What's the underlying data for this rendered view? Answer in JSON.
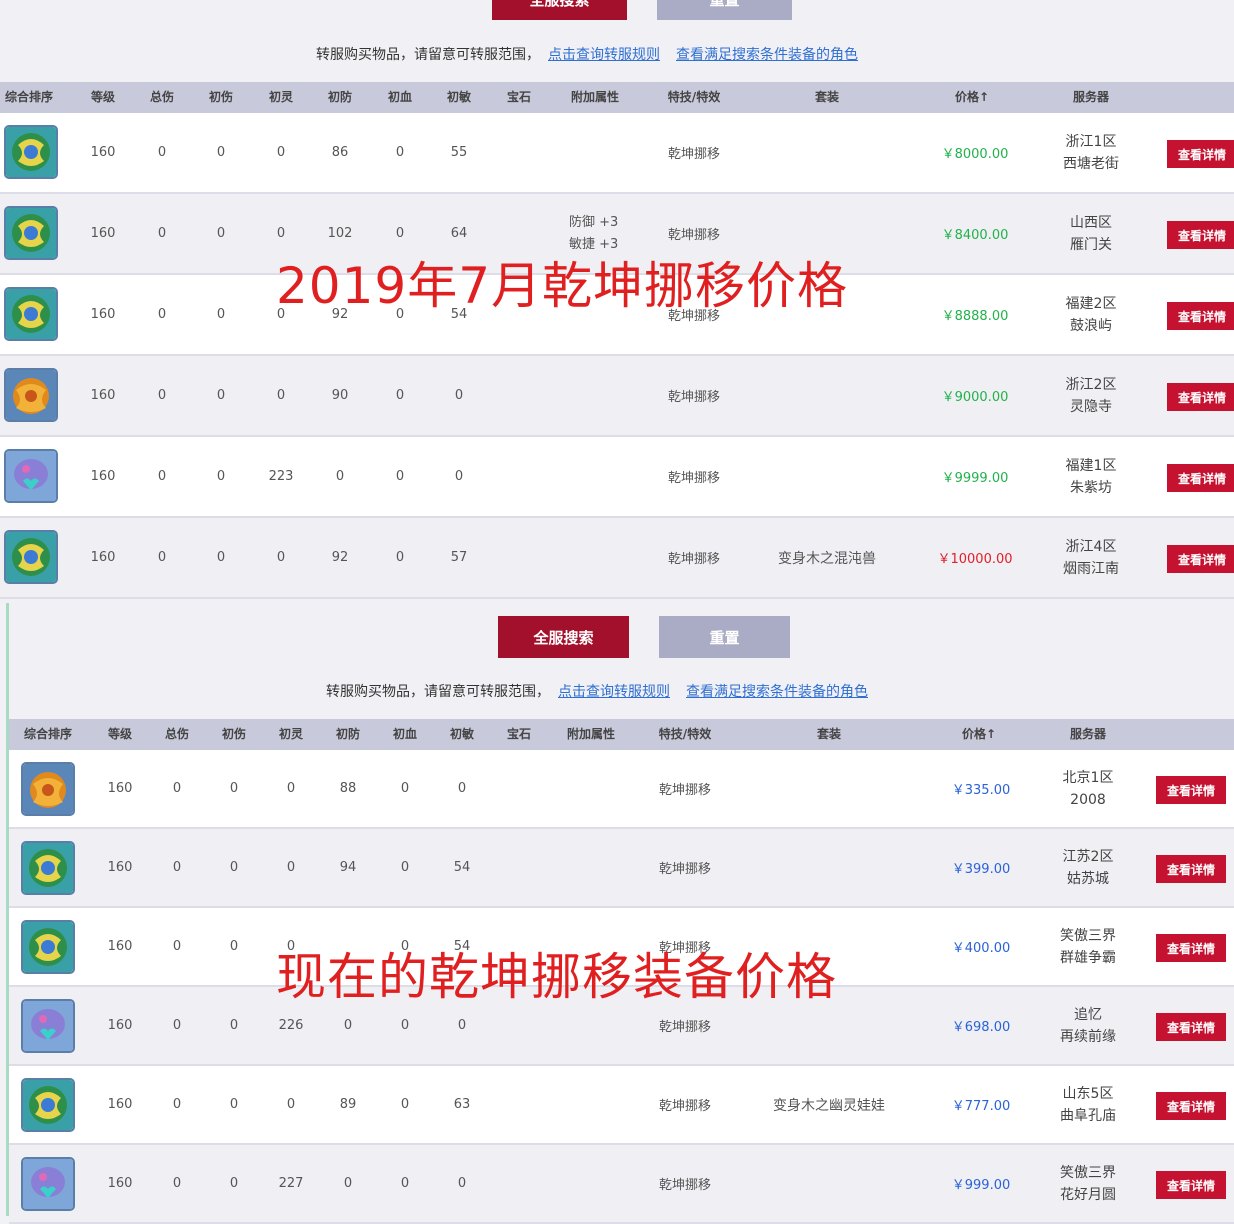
{
  "colors": {
    "search_button": "#a3102c",
    "reset_button": "#a9acc4",
    "header_bg": "#c8cadb",
    "price_green": "#22b14c",
    "price_red": "#e0202a",
    "price_blue": "#2a62d8",
    "detail_button": "#c41230",
    "overlay_text": "#e02020"
  },
  "columns": [
    "综合排序",
    "等级",
    "总伤",
    "初伤",
    "初灵",
    "初防",
    "初血",
    "初敏",
    "宝石",
    "附加属性",
    "特技/特效",
    "套装",
    "价格↑",
    "服务器"
  ],
  "top": {
    "search_label": "全服搜索",
    "reset_label": "重置",
    "notice": "转服购买物品，请留意可转服范围，",
    "notice_link1": "点击查询转服规则",
    "notice_link2": "查看满足搜索条件装备的角色",
    "overlay": "2019年7月乾坤挪移价格",
    "rows": [
      {
        "icon": "green-jade-icon",
        "level": "160",
        "total": "0",
        "init_dmg": "0",
        "init_spirit": "0",
        "init_def": "86",
        "init_hp": "0",
        "init_agi": "55",
        "attr": [],
        "skill": "乾坤挪移",
        "set": "",
        "price": "￥8000.00",
        "price_color": "green",
        "server1": "浙江1区",
        "server2": "西塘老街",
        "detail": "查看详情"
      },
      {
        "icon": "green-jade-icon",
        "level": "160",
        "total": "0",
        "init_dmg": "0",
        "init_spirit": "0",
        "init_def": "102",
        "init_hp": "0",
        "init_agi": "64",
        "attr": [
          "防御 +3",
          "敏捷 +3"
        ],
        "skill": "乾坤挪移",
        "set": "",
        "price": "￥8400.00",
        "price_color": "green",
        "server1": "山西区",
        "server2": "雁门关",
        "detail": "查看详情"
      },
      {
        "icon": "green-jade-icon",
        "level": "160",
        "total": "0",
        "init_dmg": "0",
        "init_spirit": "0",
        "init_def": "92",
        "init_hp": "0",
        "init_agi": "54",
        "attr": [],
        "skill": "乾坤挪移",
        "set": "",
        "price": "￥8888.00",
        "price_color": "green",
        "server1": "福建2区",
        "server2": "鼓浪屿",
        "detail": "查看详情"
      },
      {
        "icon": "orange-gem-icon",
        "level": "160",
        "total": "0",
        "init_dmg": "0",
        "init_spirit": "0",
        "init_def": "90",
        "init_hp": "0",
        "init_agi": "0",
        "attr": [],
        "skill": "乾坤挪移",
        "set": "",
        "price": "￥9000.00",
        "price_color": "green",
        "server1": "浙江2区",
        "server2": "灵隐寺",
        "detail": "查看详情"
      },
      {
        "icon": "blue-heart-icon",
        "level": "160",
        "total": "0",
        "init_dmg": "0",
        "init_spirit": "223",
        "init_def": "0",
        "init_hp": "0",
        "init_agi": "0",
        "attr": [],
        "skill": "乾坤挪移",
        "set": "",
        "price": "￥9999.00",
        "price_color": "green",
        "server1": "福建1区",
        "server2": "朱紫坊",
        "detail": "查看详情"
      },
      {
        "icon": "green-jade-icon",
        "level": "160",
        "total": "0",
        "init_dmg": "0",
        "init_spirit": "0",
        "init_def": "92",
        "init_hp": "0",
        "init_agi": "57",
        "attr": [],
        "skill": "乾坤挪移",
        "set": "变身木之混沌兽",
        "price": "￥10000.00",
        "price_color": "red",
        "server1": "浙江4区",
        "server2": "烟雨江南",
        "detail": "查看详情"
      }
    ]
  },
  "bottom": {
    "search_label": "全服搜索",
    "reset_label": "重置",
    "notice": "转服购买物品，请留意可转服范围，",
    "notice_link1": "点击查询转服规则",
    "notice_link2": "查看满足搜索条件装备的角色",
    "overlay": "现在的乾坤挪移装备价格",
    "rows": [
      {
        "icon": "orange-gem-icon",
        "level": "160",
        "total": "0",
        "init_dmg": "0",
        "init_spirit": "0",
        "init_def": "88",
        "init_hp": "0",
        "init_agi": "0",
        "attr": [],
        "skill": "乾坤挪移",
        "set": "",
        "price": "￥335.00",
        "price_color": "blue",
        "server1": "北京1区",
        "server2": "2008",
        "detail": "查看详情"
      },
      {
        "icon": "green-jade-icon",
        "level": "160",
        "total": "0",
        "init_dmg": "0",
        "init_spirit": "0",
        "init_def": "94",
        "init_hp": "0",
        "init_agi": "54",
        "attr": [],
        "skill": "乾坤挪移",
        "set": "",
        "price": "￥399.00",
        "price_color": "blue",
        "server1": "江苏2区",
        "server2": "姑苏城",
        "detail": "查看详情"
      },
      {
        "icon": "green-jade-icon",
        "level": "160",
        "total": "0",
        "init_dmg": "0",
        "init_spirit": "0",
        "init_def": "",
        "init_hp": "0",
        "init_agi": "54",
        "attr": [],
        "skill": "乾坤挪移",
        "set": "",
        "price": "￥400.00",
        "price_color": "blue",
        "server1": "笑傲三界",
        "server2": "群雄争霸",
        "detail": "查看详情"
      },
      {
        "icon": "blue-heart-icon",
        "level": "160",
        "total": "0",
        "init_dmg": "0",
        "init_spirit": "226",
        "init_def": "0",
        "init_hp": "0",
        "init_agi": "0",
        "attr": [],
        "skill": "乾坤挪移",
        "set": "",
        "price": "￥698.00",
        "price_color": "blue",
        "server1": "追忆",
        "server2": "再续前缘",
        "detail": "查看详情"
      },
      {
        "icon": "green-jade-icon",
        "level": "160",
        "total": "0",
        "init_dmg": "0",
        "init_spirit": "0",
        "init_def": "89",
        "init_hp": "0",
        "init_agi": "63",
        "attr": [],
        "skill": "乾坤挪移",
        "set": "变身木之幽灵娃娃",
        "price": "￥777.00",
        "price_color": "blue",
        "server1": "山东5区",
        "server2": "曲阜孔庙",
        "detail": "查看详情"
      },
      {
        "icon": "blue-heart-icon",
        "level": "160",
        "total": "0",
        "init_dmg": "0",
        "init_spirit": "227",
        "init_def": "0",
        "init_hp": "0",
        "init_agi": "0",
        "attr": [],
        "skill": "乾坤挪移",
        "set": "",
        "price": "￥999.00",
        "price_color": "blue",
        "server1": "笑傲三界",
        "server2": "花好月圆",
        "detail": "查看详情"
      }
    ]
  }
}
